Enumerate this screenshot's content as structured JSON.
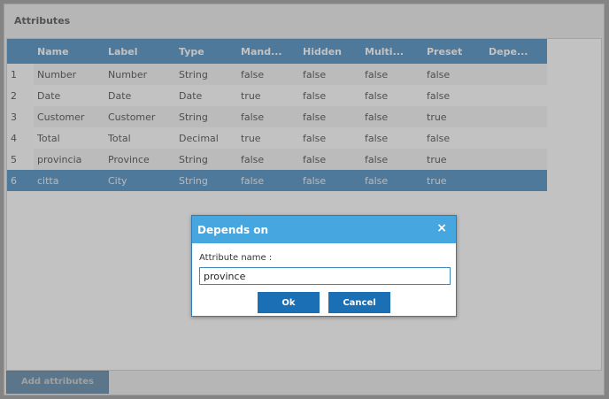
{
  "panel": {
    "title": "Attributes"
  },
  "grid": {
    "columns": [
      "",
      "Name",
      "Label",
      "Type",
      "Mand...",
      "Hidden",
      "Multi...",
      "Preset",
      "Depe..."
    ],
    "rows": [
      {
        "rn": "1",
        "name": "Number",
        "label": "Number",
        "type": "String",
        "mand": "false",
        "hidden": "false",
        "multi": "false",
        "preset": "false",
        "depe": ""
      },
      {
        "rn": "2",
        "name": "Date",
        "label": "Date",
        "type": "Date",
        "mand": "true",
        "hidden": "false",
        "multi": "false",
        "preset": "false",
        "depe": ""
      },
      {
        "rn": "3",
        "name": "Customer",
        "label": "Customer",
        "type": "String",
        "mand": "false",
        "hidden": "false",
        "multi": "false",
        "preset": "true",
        "depe": ""
      },
      {
        "rn": "4",
        "name": "Total",
        "label": "Total",
        "type": "Decimal",
        "mand": "true",
        "hidden": "false",
        "multi": "false",
        "preset": "false",
        "depe": ""
      },
      {
        "rn": "5",
        "name": "provincia",
        "label": "Province",
        "type": "String",
        "mand": "false",
        "hidden": "false",
        "multi": "false",
        "preset": "true",
        "depe": ""
      },
      {
        "rn": "6",
        "name": "citta",
        "label": "City",
        "type": "String",
        "mand": "false",
        "hidden": "false",
        "multi": "false",
        "preset": "true",
        "depe": ""
      }
    ],
    "selected_row": 6
  },
  "footer": {
    "add_label": "Add attributes"
  },
  "dialog": {
    "title": "Depends on",
    "close_icon": "×",
    "field_label": "Attribute name :",
    "field_value": "province",
    "ok_label": "Ok",
    "cancel_label": "Cancel"
  },
  "colors": {
    "header_blue": "#2f7ab8",
    "dialog_header": "#45a6e0",
    "button_blue": "#1a6fb5"
  }
}
